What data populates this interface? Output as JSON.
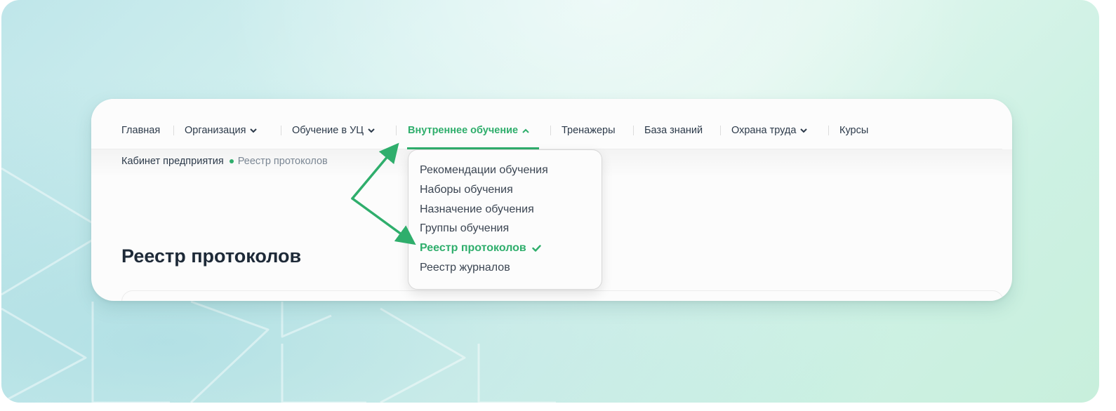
{
  "nav": {
    "items": [
      {
        "label": "Главная",
        "has_chevron": false,
        "active": false
      },
      {
        "label": "Организация",
        "has_chevron": true,
        "active": false
      },
      {
        "label": "Обучение в УЦ",
        "has_chevron": true,
        "active": false
      },
      {
        "label": "Внутреннее обучение",
        "has_chevron": true,
        "active": true
      },
      {
        "label": "Тренажеры",
        "has_chevron": false,
        "active": false
      },
      {
        "label": "База знаний",
        "has_chevron": false,
        "active": false
      },
      {
        "label": "Охрана труда",
        "has_chevron": true,
        "active": false
      },
      {
        "label": "Курсы",
        "has_chevron": false,
        "active": false
      }
    ]
  },
  "breadcrumb": {
    "parent": "Кабинет предприятия",
    "current": "Реестр протоколов"
  },
  "page": {
    "title": "Реестр протоколов"
  },
  "dropdown": {
    "items": [
      {
        "label": "Рекомендации обучения",
        "selected": false
      },
      {
        "label": "Наборы обучения",
        "selected": false
      },
      {
        "label": "Назначение обучения",
        "selected": false
      },
      {
        "label": "Группы обучения",
        "selected": false
      },
      {
        "label": "Реестр протоколов",
        "selected": true
      },
      {
        "label": "Реестр журналов",
        "selected": false
      }
    ]
  },
  "icons": {
    "nav_expand": "chevron-down-icon",
    "nav_collapse": "chevron-up-icon",
    "selected_mark": "checkmark-icon"
  },
  "colors": {
    "accent": "#2fae6c",
    "text": "#2c3a4a",
    "title": "#1e2a38",
    "muted": "#7b8794"
  }
}
